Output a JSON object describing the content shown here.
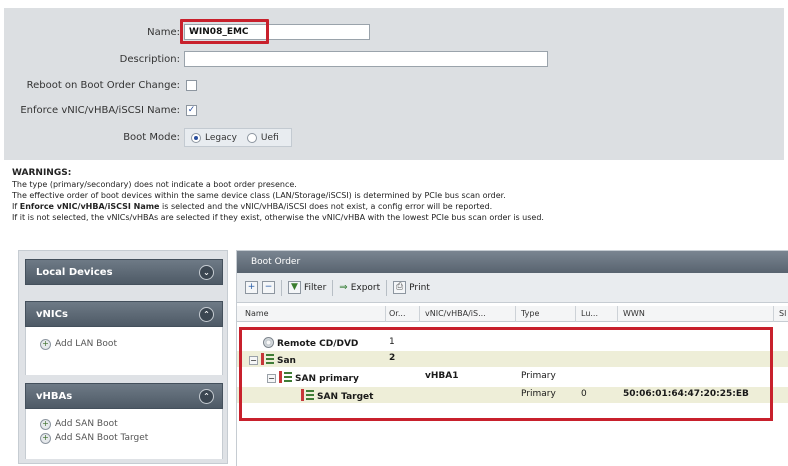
{
  "form": {
    "name_label": "Name:",
    "name_value": "WIN08_EMC",
    "description_label": "Description:",
    "description_value": "",
    "reboot_label": "Reboot on Boot Order Change:",
    "reboot_checked": false,
    "enforce_label": "Enforce vNIC/vHBA/iSCSI Name:",
    "enforce_checked": true,
    "enforce_mark": "✓",
    "bootmode_label": "Boot Mode:",
    "bootmode_options": [
      "Legacy",
      "Uefi"
    ],
    "bootmode_selected": "Legacy"
  },
  "warnings": {
    "title": "WARNINGS:",
    "line1": "The type (primary/secondary) does not indicate a boot order presence.",
    "line2": "The effective order of boot devices within the same device class (LAN/Storage/iSCSI) is determined by PCIe bus scan order.",
    "line3_pre": "If",
    "line3_bold": "Enforce vNIC/vHBA/iSCSI Name",
    "line3_post": "is selected and the vNIC/vHBA/iSCSI does not exist, a config error will be reported.",
    "line4": "If it is not selected, the vNICs/vHBAs are selected if they exist, otherwise the vNIC/vHBA with the lowest PCIe bus scan order is used."
  },
  "left_panel": {
    "local_devices": "Local Devices",
    "vnics": "vNICs",
    "add_lan_boot": "Add LAN Boot",
    "vhbas": "vHBAs",
    "add_san_boot": "Add SAN Boot",
    "add_san_boot_target": "Add SAN Boot Target"
  },
  "boot_order": {
    "title": "Boot Order",
    "toolbar": {
      "filter": "Filter",
      "export": "Export",
      "print": "Print"
    },
    "columns": [
      "Name",
      "Or...",
      "vNIC/vHBA/iS...",
      "Type",
      "Lu...",
      "WWN",
      "Sl"
    ],
    "rows": [
      {
        "name": "Remote CD/DVD",
        "order": "1",
        "vnic": "",
        "type": "",
        "lun": "",
        "wwn": ""
      },
      {
        "name": "San",
        "order": "2",
        "vnic": "",
        "type": "",
        "lun": "",
        "wwn": ""
      },
      {
        "name": "SAN primary",
        "order": "",
        "vnic": "vHBA1",
        "type": "Primary",
        "lun": "",
        "wwn": ""
      },
      {
        "name": "SAN Target",
        "order": "",
        "vnic": "",
        "type": "Primary",
        "lun": "0",
        "wwn": "50:06:01:64:47:20:25:EB"
      }
    ]
  },
  "colors": {
    "highlight": "#c8202c",
    "panel_header": "#58636f",
    "form_bg": "#dcdfe2"
  }
}
